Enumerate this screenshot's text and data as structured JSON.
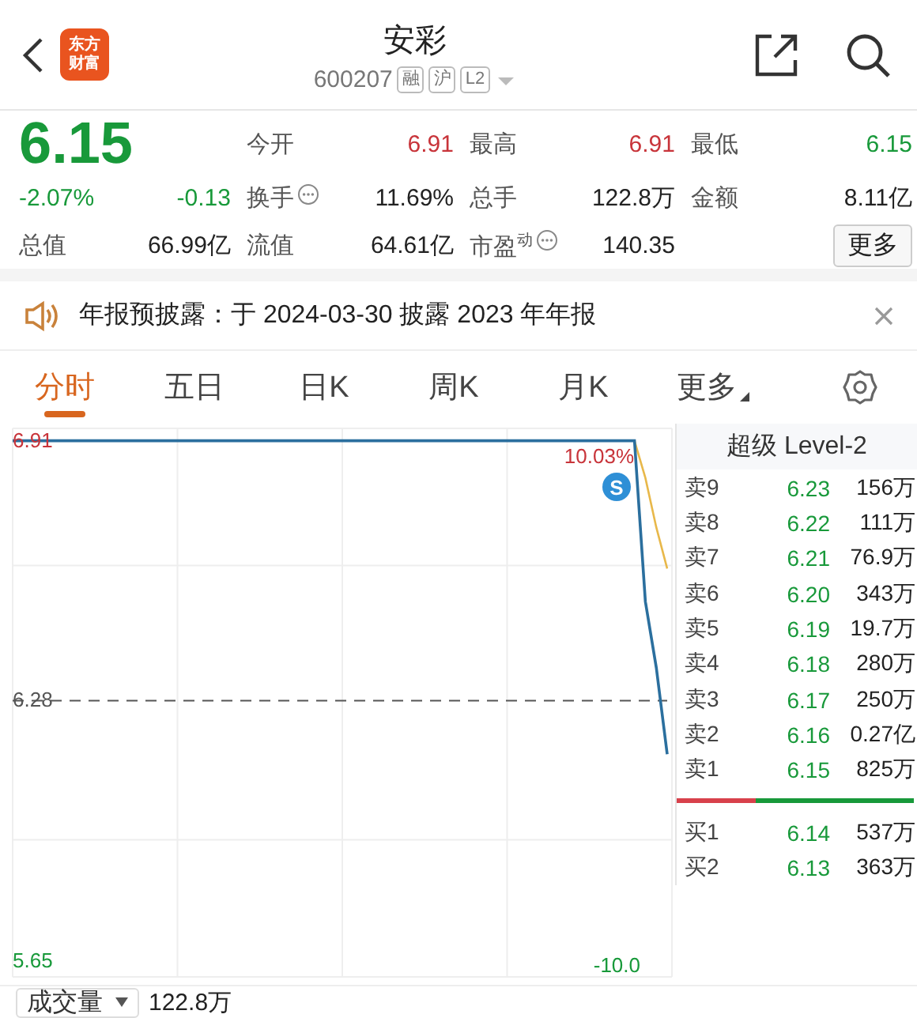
{
  "header": {
    "logo": [
      "东方",
      "财富"
    ],
    "title": "安彩",
    "code": "600207",
    "tags": [
      "融",
      "沪",
      "L2"
    ]
  },
  "quote": {
    "price": "6.15",
    "color": "#18993a",
    "change_pct": "-2.07%",
    "change": "-0.13",
    "stats": [
      {
        "label": "今开",
        "value": "6.91",
        "color": "#c8343a",
        "info": false
      },
      {
        "label": "最高",
        "value": "6.91",
        "color": "#c8343a",
        "info": false
      },
      {
        "label": "最低",
        "value": "6.15",
        "color": "#18993a",
        "info": false
      },
      {
        "label": "换手",
        "value": "11.69%",
        "color": "#222222",
        "info": true
      },
      {
        "label": "总手",
        "value": "122.8万",
        "color": "#222222",
        "info": false
      },
      {
        "label": "金额",
        "value": "8.11亿",
        "color": "#222222",
        "info": false
      },
      {
        "label": "总值",
        "value": "66.99亿",
        "color": "#222222",
        "info": false
      },
      {
        "label": "流值",
        "value": "64.61亿",
        "color": "#222222",
        "info": false
      },
      {
        "label": "市盈$^{动}$",
        "value": "140.35",
        "color": "#222222",
        "info": true
      }
    ],
    "more_button": "更多"
  },
  "notice": {
    "text": "年报预披露：于 2024-03-30 披露 2023 年年报"
  },
  "tabs": [
    {
      "label": "分时",
      "selected": true,
      "kind": "tab"
    },
    {
      "label": "五日",
      "selected": false,
      "kind": "tab"
    },
    {
      "label": "日K",
      "selected": false,
      "kind": "tab"
    },
    {
      "label": "周K",
      "selected": false,
      "kind": "tab"
    },
    {
      "label": "月K",
      "selected": false,
      "kind": "tab"
    },
    {
      "label": "更多",
      "selected": false,
      "kind": "menu"
    }
  ],
  "chart": {
    "marker": "S",
    "right_labels": [
      "10.03%",
      "-10.0"
    ],
    "chart_data": {
      "type": "line",
      "categories": [
        null,
        null,
        null,
        null,
        null,
        null,
        null,
        null,
        null,
        null,
        null,
        null,
        null,
        null,
        null,
        null,
        null,
        null,
        null,
        null,
        null,
        null,
        null,
        null,
        null,
        null,
        null,
        null,
        null,
        null,
        null,
        null,
        null,
        null,
        null,
        null,
        null,
        null,
        null,
        null,
        null,
        null,
        null,
        null,
        null,
        null,
        null,
        null,
        null,
        null,
        null,
        null,
        null,
        null,
        null,
        null,
        null,
        null,
        null,
        null,
        null
      ],
      "ylim": [
        5.61,
        6.94
      ],
      "yticks": [
        {
          "value": 6.91,
          "label": "6.91"
        },
        {
          "value": 6.28,
          "label": "6.28"
        },
        {
          "value": 5.65,
          "label": "5.65"
        }
      ],
      "series": [
        {
          "color": "#2b6f9e",
          "values": [
            6.91,
            6.91,
            6.91,
            6.91,
            6.91,
            6.91,
            6.91,
            6.91,
            6.91,
            6.91,
            6.91,
            6.91,
            6.91,
            6.91,
            6.91,
            6.91,
            6.91,
            6.91,
            6.91,
            6.91,
            6.91,
            6.91,
            6.91,
            6.91,
            6.91,
            6.91,
            6.91,
            6.91,
            6.91,
            6.91,
            6.91,
            6.91,
            6.91,
            6.91,
            6.91,
            6.91,
            6.91,
            6.91,
            6.91,
            6.91,
            6.91,
            6.91,
            6.91,
            6.91,
            6.91,
            6.91,
            6.91,
            6.91,
            6.91,
            6.91,
            6.91,
            6.91,
            6.91,
            6.91,
            6.91,
            6.91,
            6.91,
            6.91,
            6.52,
            6.36,
            6.15
          ]
        },
        {
          "color": "#e8b84a",
          "values": [
            null,
            null,
            null,
            null,
            null,
            null,
            null,
            null,
            null,
            null,
            null,
            null,
            null,
            null,
            null,
            null,
            null,
            null,
            null,
            null,
            null,
            null,
            null,
            null,
            null,
            null,
            null,
            null,
            null,
            null,
            null,
            null,
            null,
            null,
            null,
            null,
            null,
            null,
            null,
            null,
            null,
            null,
            null,
            null,
            null,
            null,
            null,
            null,
            null,
            null,
            null,
            null,
            null,
            null,
            null,
            null,
            null,
            6.91,
            6.82,
            6.7,
            6.6
          ]
        },
        {
          "color": "#555555",
          "line_style": "dashed",
          "values": [
            6.28,
            6.28,
            6.28,
            6.28,
            6.28,
            6.28,
            6.28,
            6.28,
            6.28,
            6.28,
            6.28,
            6.28,
            6.28,
            6.28,
            6.28,
            6.28,
            6.28,
            6.28,
            6.28,
            6.28,
            6.28,
            6.28,
            6.28,
            6.28,
            6.28,
            6.28,
            6.28,
            6.28,
            6.28,
            6.28,
            6.28,
            6.28,
            6.28,
            6.28,
            6.28,
            6.28,
            6.28,
            6.28,
            6.28,
            6.28,
            6.28,
            6.28,
            6.28,
            6.28,
            6.28,
            6.28,
            6.28,
            6.28,
            6.28,
            6.28,
            6.28,
            6.28,
            6.28,
            6.28,
            6.28,
            6.28,
            6.28,
            6.28,
            6.28,
            6.28,
            6.28
          ]
        }
      ]
    }
  },
  "order_book": {
    "title": "超级 Level-2",
    "level": 0.33,
    "asks": [
      {
        "label": "卖9",
        "price": "6.23",
        "volume": "156万",
        "color": "#18993a"
      },
      {
        "label": "卖8",
        "price": "6.22",
        "volume": "111万",
        "color": "#18993a"
      },
      {
        "label": "卖7",
        "price": "6.21",
        "volume": "76.9万",
        "color": "#18993a"
      },
      {
        "label": "卖6",
        "price": "6.20",
        "volume": "343万",
        "color": "#18993a"
      },
      {
        "label": "卖5",
        "price": "6.19",
        "volume": "19.7万",
        "color": "#18993a"
      },
      {
        "label": "卖4",
        "price": "6.18",
        "volume": "280万",
        "color": "#18993a"
      },
      {
        "label": "卖3",
        "price": "6.17",
        "volume": "250万",
        "color": "#18993a"
      },
      {
        "label": "卖2",
        "price": "6.16",
        "volume": "0.27亿",
        "color": "#18993a"
      },
      {
        "label": "卖1",
        "price": "6.15",
        "volume": "825万",
        "color": "#18993a"
      }
    ],
    "bids": [
      {
        "label": "买1",
        "price": "6.14",
        "volume": "537万",
        "color": "#18993a"
      },
      {
        "label": "买2",
        "price": "6.13",
        "volume": "363万",
        "color": "#18993a"
      }
    ]
  },
  "volume": {
    "selector": "成交量",
    "value": "122.8万"
  }
}
